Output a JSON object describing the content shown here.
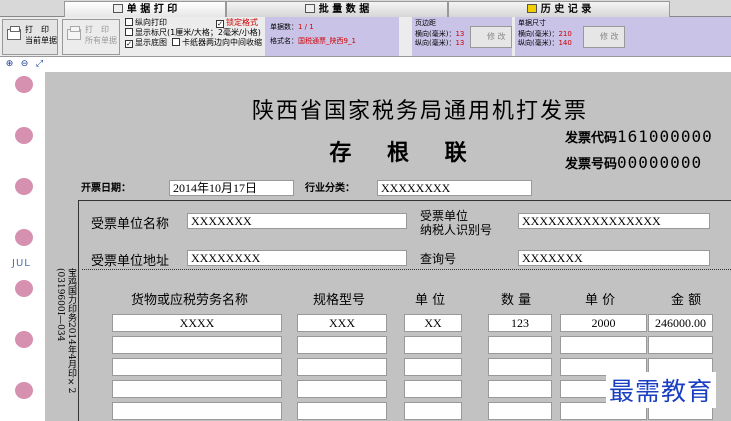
{
  "tabs": [
    {
      "label": "单 据 打 印"
    },
    {
      "label": "批 量 数 据"
    },
    {
      "label": "历 史 记 录"
    }
  ],
  "toolbar": {
    "print_current": {
      "line1": "打　印",
      "line2": "当前单据"
    },
    "print_all": {
      "line1": "打　印",
      "line2": "所有单据"
    },
    "options": {
      "portrait_print": "纵向打印",
      "show_ruler": "显示标尺(1厘米/大格；2毫米/小格)",
      "show_background": "显示底图",
      "tractor_center": "卡纸器两边向中间收缩",
      "lock_format": "锁定格式"
    },
    "doc_count_label": "单据数：",
    "doc_count_value": "1 / 1",
    "format_name_label": "格式名：",
    "format_name_value": "国税通票_陕西9_1",
    "margin": {
      "title": "页边距",
      "h_label": "横向(毫米)：",
      "h_value": "13",
      "v_label": "纵向(毫米)：",
      "v_value": "13",
      "button": "修 改"
    },
    "size": {
      "title": "单据尺寸",
      "h_label": "横向(毫米)：",
      "h_value": "210",
      "v_label": "纵向(毫米)：",
      "v_value": "140",
      "button": "修 改"
    }
  },
  "invoice": {
    "title": "陕西省国家税务局通用机打发票",
    "subtitle": "存 根 联",
    "code_label": "发票代码",
    "code_value": "161000000",
    "number_label": "发票号码",
    "number_value": "00000000",
    "date_label": "开票日期：",
    "date_value": "2014年10月17日",
    "industry_label": "行业分类：",
    "industry_value": "XXXXXXXX",
    "payer_name_label": "受票单位名称",
    "payer_name_value": "XXXXXXX",
    "payer_tax_label_1": "受票单位",
    "payer_tax_label_2": "纳税人识别号",
    "payer_tax_value": "XXXXXXXXXXXXXXXX",
    "payer_addr_label": "受票单位地址",
    "payer_addr_value": "XXXXXXXX",
    "query_label": "查询号",
    "query_value": "XXXXXXX",
    "side_text": "宝鸡国力印务2014年4月印×2 (0319600I—034",
    "columns": [
      "货物或应税劳务名称",
      "规格型号",
      "单 位",
      "数 量",
      "单 价",
      "金 额"
    ],
    "rows": [
      [
        "XXXX",
        "XXX",
        "XX",
        "123",
        "2000",
        "246000.00"
      ]
    ]
  },
  "side_mark": "JUL",
  "watermark": "最需教育"
}
